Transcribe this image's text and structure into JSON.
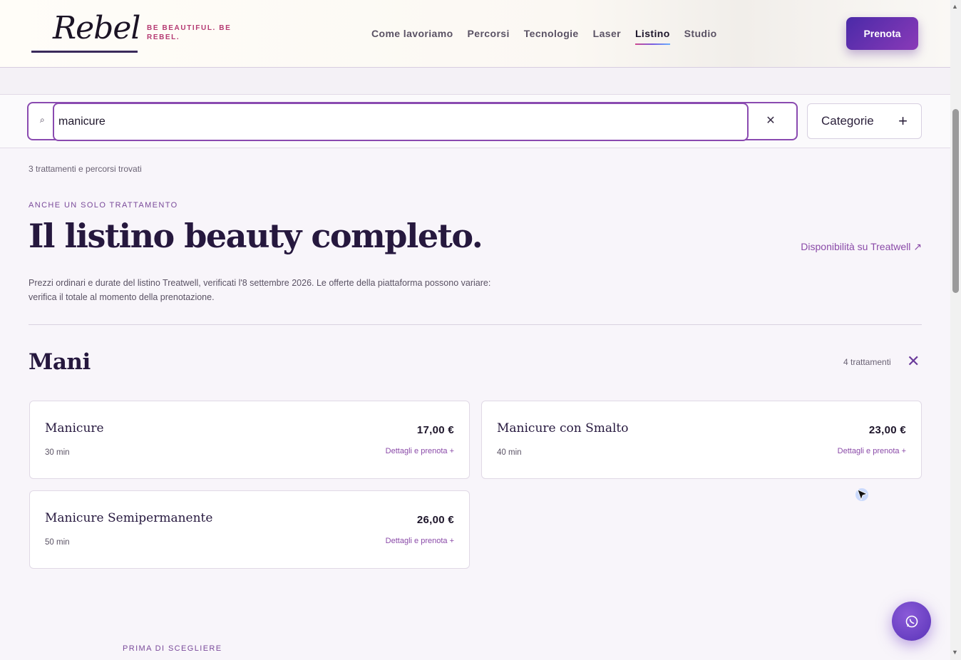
{
  "header": {
    "logo_text": "Rebel",
    "tagline": "BE BEAUTIFUL. BE REBEL.",
    "nav": [
      {
        "label": "Come lavoriamo",
        "active": false
      },
      {
        "label": "Percorsi",
        "active": false
      },
      {
        "label": "Tecnologie",
        "active": false
      },
      {
        "label": "Laser",
        "active": false
      },
      {
        "label": "Listino",
        "active": true
      },
      {
        "label": "Studio",
        "active": false
      }
    ],
    "cta_label": "Prenota"
  },
  "search": {
    "value": "manicure",
    "clear_icon": "close-icon",
    "categories_label": "Categorie",
    "categories_icon": "plus-icon"
  },
  "results": {
    "count_text": "3 trattamenti e percorsi trovati"
  },
  "intro": {
    "eyebrow": "ANCHE UN SOLO TRATTAMENTO",
    "title": "Il listino beauty completo.",
    "availability_link": "Disponibilità su Treatwell ↗",
    "note": "Prezzi ordinari e durate del listino Treatwell, verificati l'8 settembre 2026. Le offerte della piattaforma possono variare: verifica il totale al momento della prenotazione."
  },
  "section": {
    "title": "Mani",
    "count": "4 trattamenti",
    "treatments": [
      {
        "name": "Manicure",
        "duration": "30 min",
        "price": "17,00 €",
        "details": "Dettagli e prenota +"
      },
      {
        "name": "Manicure con Smalto",
        "duration": "40 min",
        "price": "23,00 €",
        "details": "Dettagli e prenota +"
      },
      {
        "name": "Manicure Semipermanente",
        "duration": "50 min",
        "price": "26,00 €",
        "details": "Dettagli e prenota +"
      }
    ]
  },
  "footer": {
    "eyebrow": "PRIMA DI SCEGLIERE"
  },
  "colors": {
    "accent": "#8a4ab0",
    "brand_dark": "#26183e",
    "cta_gradient_start": "#4a2aa8",
    "cta_gradient_end": "#8a3ab8",
    "tagline": "#b53a72"
  },
  "icons": {
    "chat_button": "whatsapp-icon",
    "search": "search-icon"
  }
}
